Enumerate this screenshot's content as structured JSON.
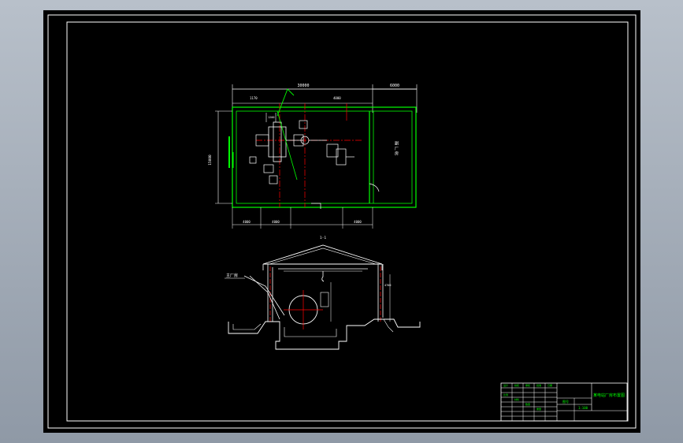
{
  "viewer": {
    "background": "#a4acb6",
    "sheet_color": "#000000"
  },
  "colors": {
    "wall": "#00ff00",
    "line": "#ffffff",
    "center": "#ff0000",
    "detail": "#00ff00"
  },
  "plan": {
    "overall_width_dim": "30000",
    "annex_width_dim": "6000",
    "spacing_dims": [
      "4000",
      "4000",
      "4000"
    ],
    "left_height_dim": "15000",
    "annex_room_label": "副 厂 房"
  },
  "section": {
    "title": "1-1",
    "elevation_tag": "主厂房"
  },
  "title_block": {
    "project_title": "某电站厂房布置图",
    "drawing_no": "图号",
    "scale": "1:100"
  }
}
